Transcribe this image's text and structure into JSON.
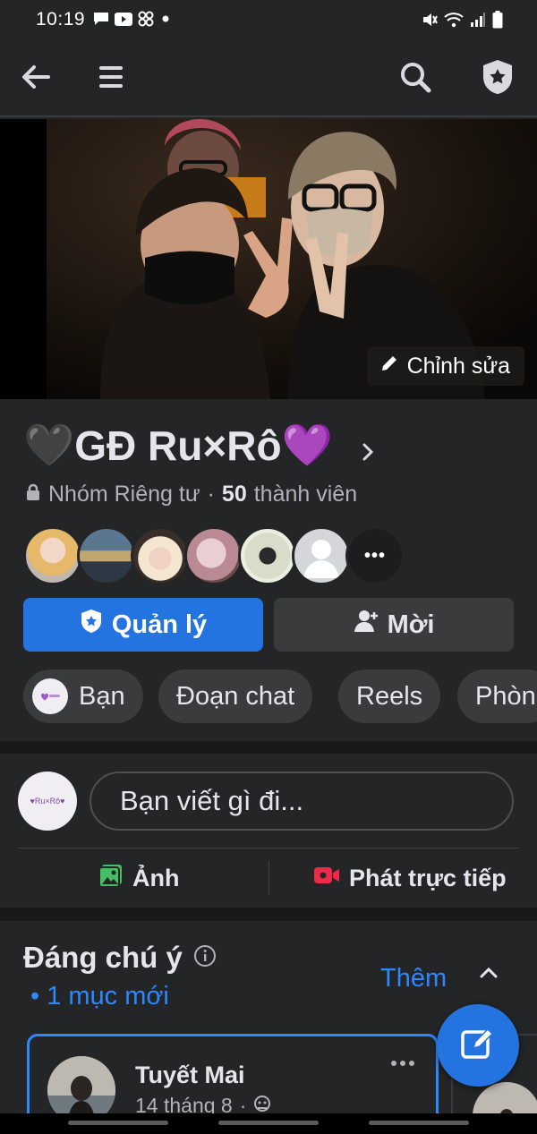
{
  "status_bar": {
    "time": "10:19",
    "left_icons": [
      "message-icon",
      "youtube-icon",
      "app-icon",
      "dot-icon"
    ],
    "right_icons": [
      "mute-icon",
      "wifi-icon",
      "signal-icon",
      "battery-icon"
    ]
  },
  "top_bar": {
    "icons": [
      "back-arrow-icon",
      "menu-icon",
      "search-icon",
      "admin-shield-icon"
    ]
  },
  "cover": {
    "edit_label": "Chỉnh sửa"
  },
  "group": {
    "name": "GĐ Ru×Rô",
    "name_prefix_emoji": "🖤",
    "name_suffix_emoji": "💜",
    "privacy": "Nhóm Riêng tư",
    "separator": "·",
    "member_count": "50",
    "member_label": "thành viên",
    "member_avatars": [
      "member-1",
      "member-2",
      "member-3",
      "member-4",
      "member-5",
      "member-6",
      "more-members"
    ],
    "more_members_label": "•••",
    "manage_label": "Quản lý",
    "invite_label": "Mời"
  },
  "tabs": [
    {
      "label": "Bạn"
    },
    {
      "label": "Đoạn chat"
    },
    {
      "label": "Reels"
    },
    {
      "label": "Phòn"
    }
  ],
  "composer": {
    "placeholder": "Bạn viết gì đi...",
    "avatar_text": "♥Ru×Rô♥",
    "photo_label": "Ảnh",
    "live_label": "Phát trực tiếp"
  },
  "featured": {
    "title": "Đáng chú ý",
    "new_items": "• 1 mục mới",
    "more_label": "Thêm",
    "post": {
      "author": "Tuyết Mai",
      "date": "14 tháng 8",
      "date_separator": "·"
    }
  },
  "colors": {
    "background": "#242526",
    "accent_blue": "#2374e1",
    "link_blue": "#2d88ff",
    "button_gray": "#3a3b3c",
    "live_red": "#f02849",
    "photo_green": "#45bd62"
  }
}
